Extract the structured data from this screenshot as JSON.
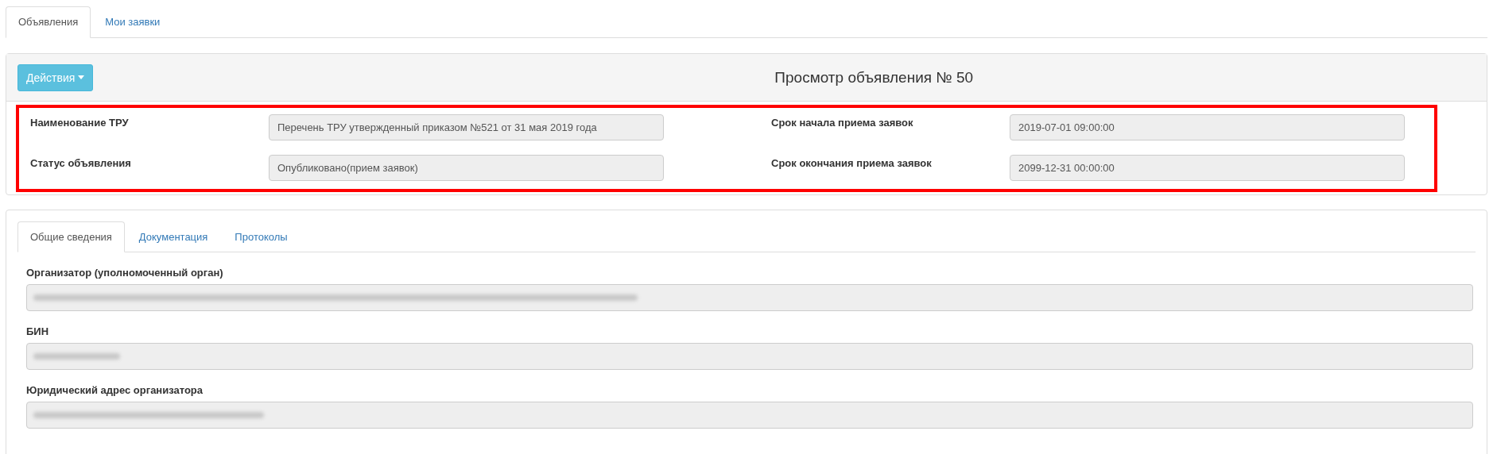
{
  "top_tabs": [
    {
      "label": "Объявления",
      "selected": true
    },
    {
      "label": "Мои заявки",
      "selected": false
    }
  ],
  "header": {
    "actions_button": "Действия",
    "title": "Просмотр объявления № 50"
  },
  "summary": {
    "highlighted": true,
    "left": [
      {
        "label": "Наименование ТРУ",
        "value": "Перечень ТРУ утвержденный приказом №521 от 31 мая 2019 года"
      },
      {
        "label": "Статус объявления",
        "value": "Опубликовано(прием заявок)"
      }
    ],
    "right": [
      {
        "label": "Срок начала приема заявок",
        "value": "2019-07-01 09:00:00"
      },
      {
        "label": "Срок окончания приема заявок",
        "value": "2099-12-31 00:00:00"
      }
    ]
  },
  "detail_tabs": [
    {
      "label": "Общие сведения",
      "selected": true
    },
    {
      "label": "Документация",
      "selected": false
    },
    {
      "label": "Протоколы",
      "selected": false
    }
  ],
  "fields": [
    {
      "label": "Организатор (уполномоченный орган)",
      "redacted": true
    },
    {
      "label": "БИН",
      "redacted": true
    },
    {
      "label": "Юридический адрес организатора",
      "redacted": true
    }
  ]
}
